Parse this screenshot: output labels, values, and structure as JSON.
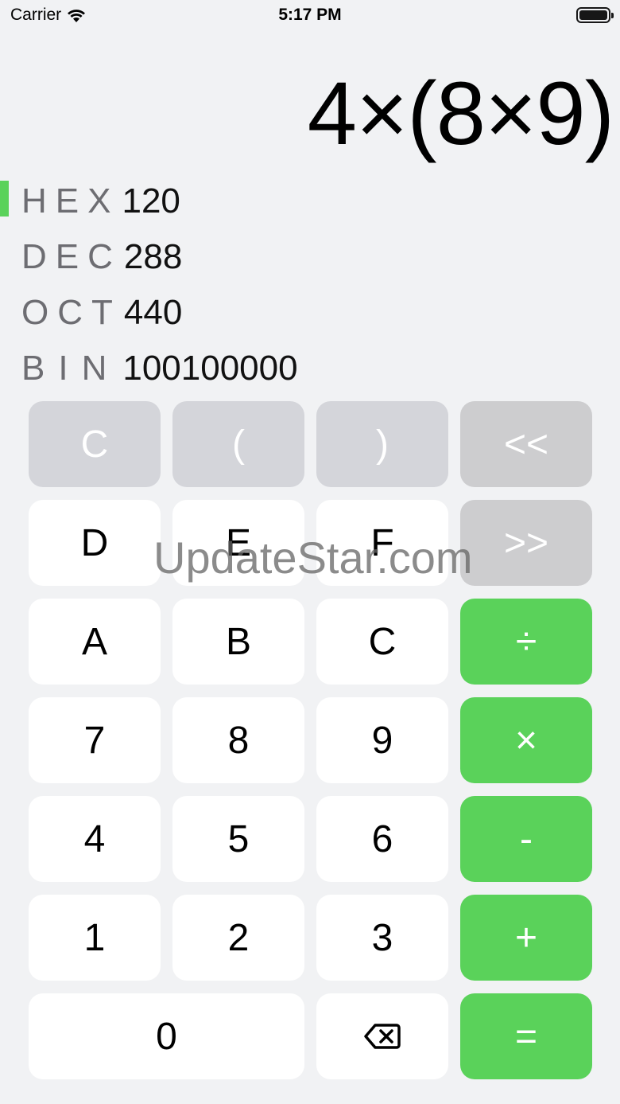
{
  "status_bar": {
    "carrier": "Carrier",
    "time": "5:17 PM",
    "icons": [
      "wifi-icon",
      "battery-icon"
    ]
  },
  "display": {
    "expression": "4×(8×9)"
  },
  "bases": [
    {
      "label": "HEX",
      "value": "120",
      "active": true
    },
    {
      "label": "DEC",
      "value": "288",
      "active": false
    },
    {
      "label": "OCT",
      "value": "440",
      "active": false
    },
    {
      "label": "BIN",
      "value": "100100000",
      "active": false
    }
  ],
  "keys": {
    "clear": "C",
    "paren_open": "(",
    "paren_close": ")",
    "shift_left": "<<",
    "d": "D",
    "e": "E",
    "f": "F",
    "shift_right": ">>",
    "a": "A",
    "b": "B",
    "c": "C",
    "divide": "÷",
    "seven": "7",
    "eight": "8",
    "nine": "9",
    "multiply": "×",
    "four": "4",
    "five": "5",
    "six": "6",
    "minus": "-",
    "one": "1",
    "two": "2",
    "three": "3",
    "plus": "+",
    "zero": "0",
    "backspace_icon": "backspace-icon",
    "equals": "="
  },
  "watermark": "UpdateStar.com",
  "colors": {
    "accent": "#5ad25a",
    "background": "#f1f2f4",
    "function_key": "#d4d5da",
    "shift_key": "#cdcdcf",
    "digit_key": "#ffffff"
  }
}
